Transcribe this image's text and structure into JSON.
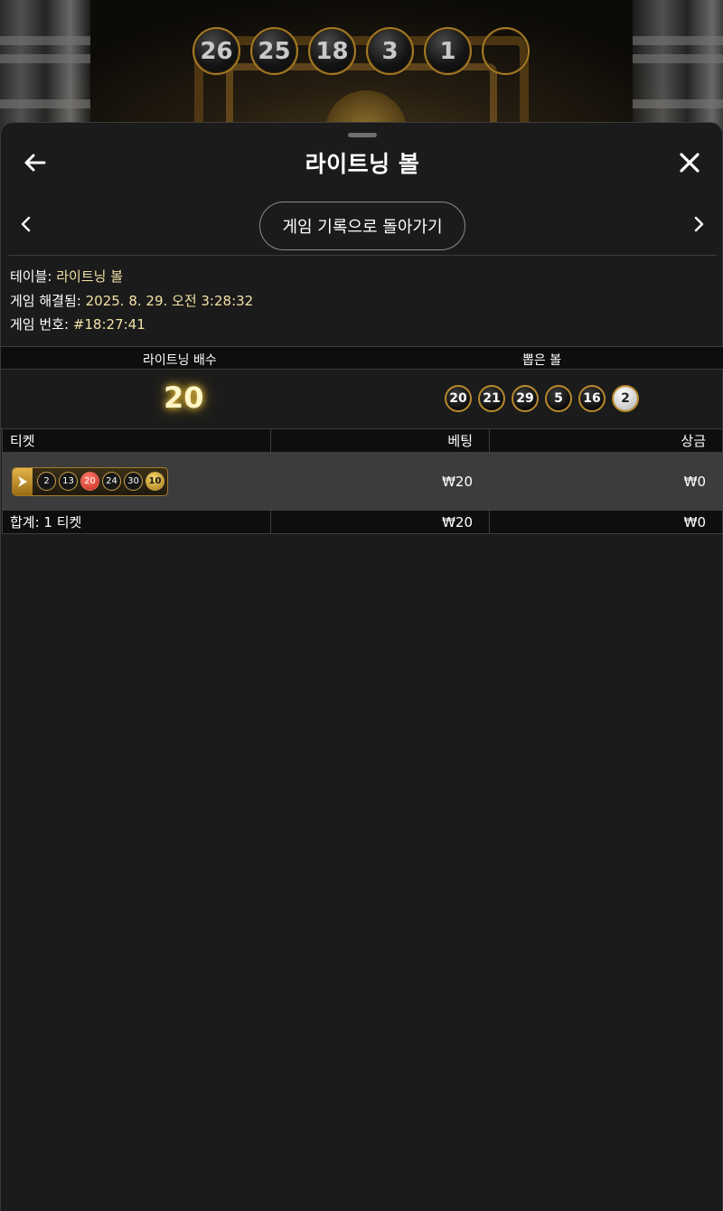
{
  "top_balls": [
    "26",
    "25",
    "18",
    "3",
    "1",
    ""
  ],
  "header": {
    "title": "라이트닝 볼",
    "back_icon": "arrow-left-icon",
    "close_icon": "close-icon"
  },
  "nav": {
    "prev_icon": "chevron-left-icon",
    "next_icon": "chevron-right-icon",
    "history_button_label": "게임 기록으로 돌아가기"
  },
  "info": {
    "table_label": "테이블:",
    "table_value": "라이트닝 볼",
    "resolved_label": "게임 해결됨:",
    "resolved_value": "2025. 8. 29. 오전 3:28:32",
    "game_number_label": "게임 번호:",
    "game_number_value": "#18:27:41"
  },
  "summary": {
    "multiplier_header": "라이트닝 배수",
    "drawn_header": "뽑은 볼",
    "multiplier_value": "20",
    "drawn_balls": [
      "20",
      "21",
      "29",
      "5",
      "16",
      "2"
    ],
    "drawn_balls_highlight_last": true
  },
  "tickets": {
    "headers": {
      "ticket": "티켓",
      "bet": "베팅",
      "payout": "상금"
    },
    "rows": [
      {
        "balls": [
          "2",
          "13",
          "20",
          "24",
          "30",
          "10"
        ],
        "matched_ball": "20",
        "bonus_ball": "10",
        "bet": "₩20",
        "payout": "₩0"
      }
    ],
    "total": {
      "label": "합계: 1 티켓",
      "bet": "₩20",
      "payout": "₩0"
    }
  },
  "colors": {
    "panel_bg": "#1b1b1b",
    "accent_gold": "#b8892c",
    "info_value": "#f3e2a6",
    "matched_red": "#c62c1d"
  }
}
